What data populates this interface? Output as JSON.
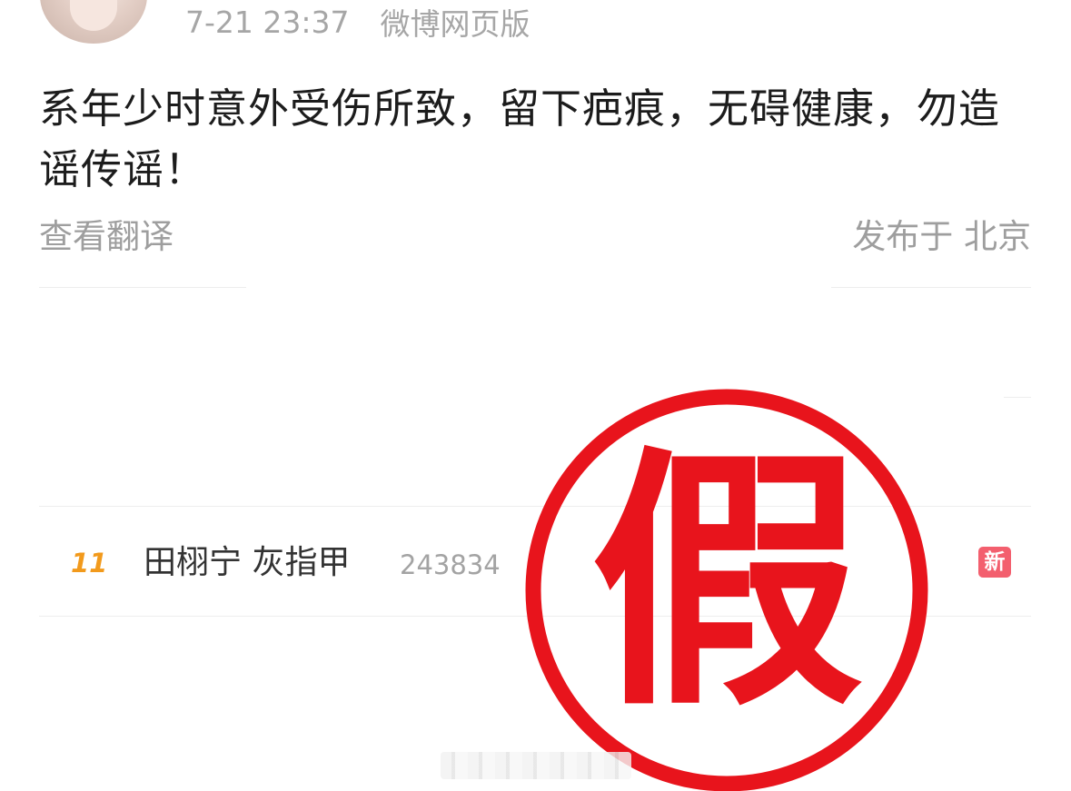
{
  "post": {
    "time": "7-21 23:37",
    "source": "微博网页版",
    "content": "系年少时意外受伤所致，留下疤痕，无碍健康，勿造谣传谣！",
    "translate_label": "查看翻译",
    "location": "发布于 北京"
  },
  "trending": {
    "rank": "11",
    "topic": "田栩宁 灰指甲",
    "heat": "243834",
    "badge": "新"
  },
  "stamp": {
    "text": "假",
    "color": "#e8141c"
  },
  "icons": [
    "avatar",
    "new-badge-icon",
    "fake-stamp-icon"
  ]
}
